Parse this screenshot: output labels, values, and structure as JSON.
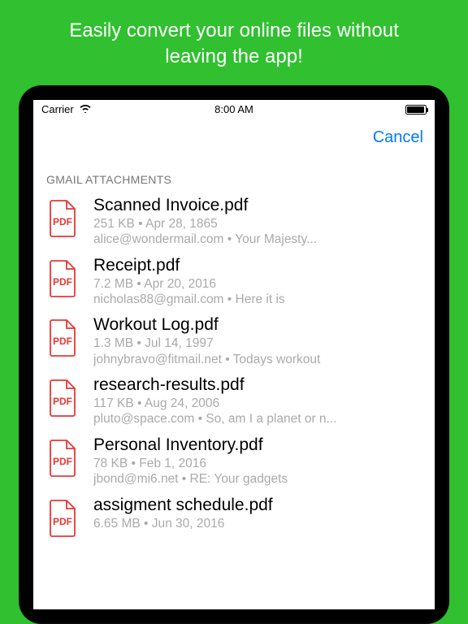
{
  "promo": {
    "line1": "Easily convert your online files without",
    "line2": "leaving the app!"
  },
  "status": {
    "carrier": "Carrier",
    "time": "8:00 AM"
  },
  "nav": {
    "cancel": "Cancel"
  },
  "section_header": "GMAIL ATTACHMENTS",
  "bullet": "•",
  "items": [
    {
      "title": "Scanned Invoice.pdf",
      "size": "251 KB",
      "date": "Apr 28, 1865",
      "from": "alice@wondermail.com",
      "subject": "Your Majesty..."
    },
    {
      "title": "Receipt.pdf",
      "size": "7.2 MB",
      "date": "Apr 20, 2016",
      "from": "nicholas88@gmail.com",
      "subject": "Here it is"
    },
    {
      "title": "Workout Log.pdf",
      "size": "1.3 MB",
      "date": "Jul 14, 1997",
      "from": "johnybravo@fitmail.net",
      "subject": "Todays workout"
    },
    {
      "title": "research-results.pdf",
      "size": "117 KB",
      "date": "Aug 24, 2006",
      "from": "pluto@space.com",
      "subject": "So, am I a planet or n..."
    },
    {
      "title": "Personal Inventory.pdf",
      "size": "78 KB",
      "date": "Feb 1, 2016",
      "from": "jbond@mi6.net",
      "subject": "RE: Your gadgets"
    },
    {
      "title": "assigment schedule.pdf",
      "size": "6.65 MB",
      "date": "Jun 30, 2016",
      "from": "",
      "subject": ""
    }
  ]
}
